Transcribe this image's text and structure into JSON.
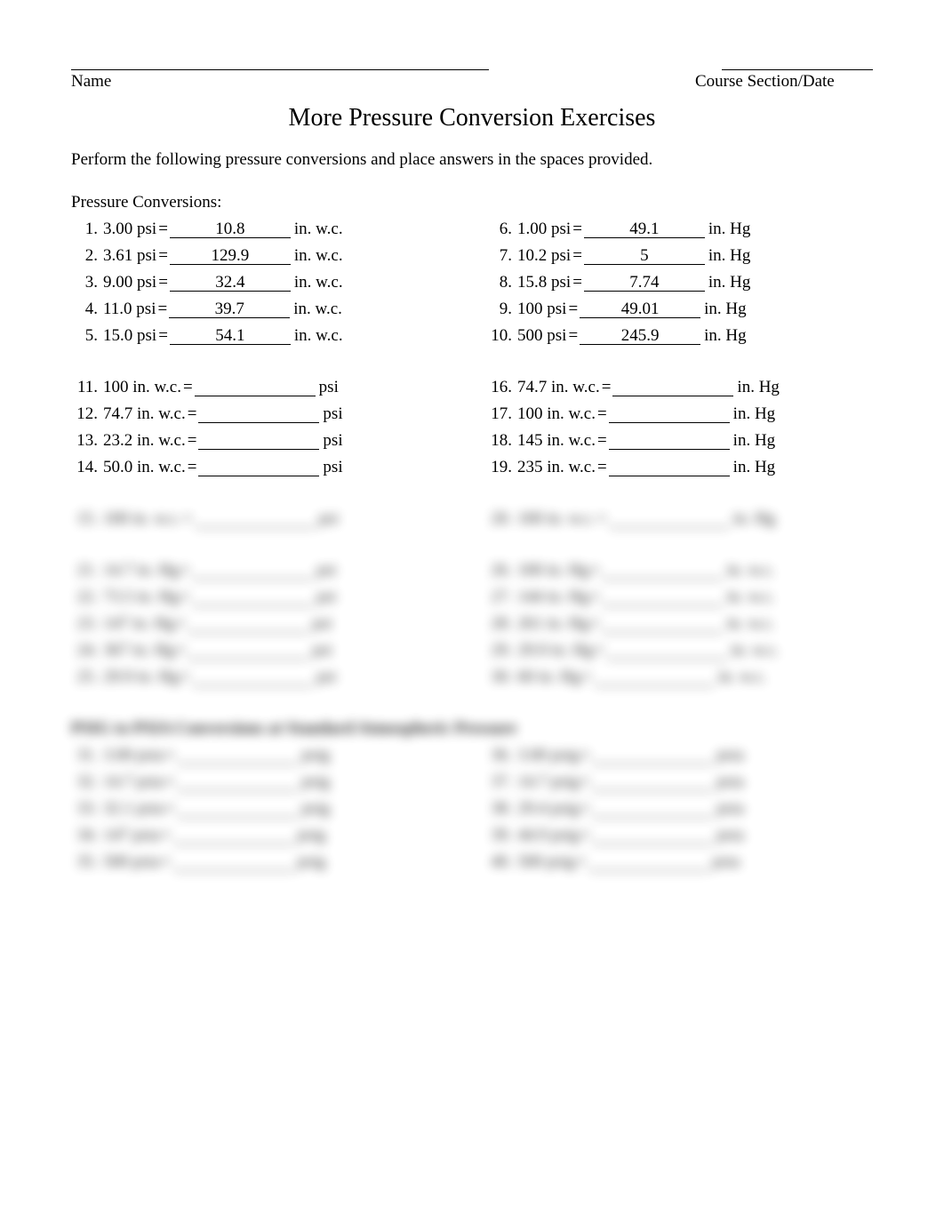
{
  "header": {
    "name_label": "Name",
    "section_label": "Course Section/Date"
  },
  "title": "More Pressure Conversion Exercises",
  "instruction": "Perform the following pressure conversions and place answers in the spaces provided.",
  "section_title": "Pressure Conversions:",
  "group1": {
    "left": [
      {
        "n": "1.",
        "lhs": "3.00 psi",
        "ans": "___10.8_________",
        "unit": "in. w.c."
      },
      {
        "n": "2.",
        "lhs": "3.61 psi",
        "ans": "_______129.9_____",
        "unit": "in. w.c."
      },
      {
        "n": "3.",
        "lhs": "9.00 psi",
        "ans": "__32.4__________",
        "unit": "in. w.c."
      },
      {
        "n": "4.",
        "lhs": "11.0 psi",
        "ans": "_________39.7___",
        "unit": "in. w.c."
      },
      {
        "n": "5.",
        "lhs": "15.0 psi",
        "ans": "____54.1________",
        "unit": "in. w.c."
      }
    ],
    "right": [
      {
        "n": "6.",
        "lhs": "1.00 psi",
        "ans": "__49.1__________",
        "unit": "in. Hg"
      },
      {
        "n": "7.",
        "lhs": "10.2 psi",
        "ans": "________5____",
        "unit": "in. Hg"
      },
      {
        "n": "8.",
        "lhs": "15.8 psi",
        "ans": "__7.74__________",
        "unit": "in. Hg"
      },
      {
        "n": "9.",
        "lhs": "100 psi",
        "ans": "_______49.01_____",
        "unit": "in. Hg"
      },
      {
        "n": "10.",
        "lhs": "500 psi",
        "ans": "__245.9__________",
        "unit": "in. Hg"
      }
    ]
  },
  "group2": {
    "left": [
      {
        "n": "11.",
        "lhs": "100 in. w.c.",
        "ans": "____________",
        "unit": "psi"
      },
      {
        "n": "12.",
        "lhs": "74.7 in. w.c.",
        "ans": "____________",
        "unit": "psi"
      },
      {
        "n": "13.",
        "lhs": "23.2 in. w.c.",
        "ans": "____________",
        "unit": "psi"
      },
      {
        "n": "14.",
        "lhs": "50.0 in. w.c.",
        "ans": "____________",
        "unit": "psi"
      }
    ],
    "right": [
      {
        "n": "16.",
        "lhs": "74.7 in. w.c.",
        "ans": "____________",
        "unit": "in. Hg"
      },
      {
        "n": "17.",
        "lhs": "100 in. w.c.",
        "ans": "____________",
        "unit": "in. Hg"
      },
      {
        "n": "18.",
        "lhs": "145 in. w.c.",
        "ans": "____________",
        "unit": "in. Hg"
      },
      {
        "n": "19.",
        "lhs": "235 in. w.c.",
        "ans": "____________",
        "unit": "in. Hg"
      }
    ]
  },
  "blurred": {
    "row15": {
      "n": "15.",
      "lhs": "100 in. w.c.",
      "ans": "____________",
      "unit": "psi"
    },
    "row20": {
      "n": "20.",
      "lhs": "100 in. w.c.",
      "ans": "____________",
      "unit": "in. Hg"
    },
    "g3left": [
      {
        "n": "21.",
        "lhs": "14.7 in. Hg",
        "ans": "____________",
        "unit": "psi"
      },
      {
        "n": "22.",
        "lhs": "73.5 in. Hg",
        "ans": "____________",
        "unit": "psi"
      },
      {
        "n": "23.",
        "lhs": "147 in. Hg",
        "ans": "____________",
        "unit": "psi"
      },
      {
        "n": "24.",
        "lhs": "367 in. Hg",
        "ans": "____________",
        "unit": "psi"
      },
      {
        "n": "25.",
        "lhs": "29.9 in. Hg",
        "ans": "____________",
        "unit": "psi"
      }
    ],
    "g3right": [
      {
        "n": "26.",
        "lhs": "100 in. Hg",
        "ans": "____________",
        "unit": "in. w.c."
      },
      {
        "n": "27.",
        "lhs": "144 in. Hg",
        "ans": "____________",
        "unit": "in. w.c."
      },
      {
        "n": "28.",
        "lhs": "261 in. Hg",
        "ans": "____________",
        "unit": "in. w.c."
      },
      {
        "n": "29.",
        "lhs": "29.9 in. Hg",
        "ans": "____________",
        "unit": "in. w.c."
      },
      {
        "n": "30.",
        "lhs": "60 in. Hg",
        "ans": "____________",
        "unit": "in. w.c."
      }
    ],
    "heading": "PSIG to PSIA Conversions at Standard Atmospheric Pressure",
    "g4left": [
      {
        "n": "31.",
        "lhs": "3.00 psia",
        "ans": "____________",
        "unit": "psig"
      },
      {
        "n": "32.",
        "lhs": "14.7 psia",
        "ans": "____________",
        "unit": "psig"
      },
      {
        "n": "33.",
        "lhs": "32.1 psia",
        "ans": "____________",
        "unit": "psig"
      },
      {
        "n": "34.",
        "lhs": "147 psia",
        "ans": "____________",
        "unit": "psig"
      },
      {
        "n": "35.",
        "lhs": "500 psia",
        "ans": "____________",
        "unit": "psig"
      }
    ],
    "g4right": [
      {
        "n": "36.",
        "lhs": "3.00 psig",
        "ans": "____________",
        "unit": "psia"
      },
      {
        "n": "37.",
        "lhs": "14.7 psig",
        "ans": "____________",
        "unit": "psia"
      },
      {
        "n": "38.",
        "lhs": "29.4 psig",
        "ans": "____________",
        "unit": "psia"
      },
      {
        "n": "39.",
        "lhs": "44.9 psig",
        "ans": "____________",
        "unit": "psia"
      },
      {
        "n": "40.",
        "lhs": "500 psig",
        "ans": "____________",
        "unit": "psia"
      }
    ]
  }
}
